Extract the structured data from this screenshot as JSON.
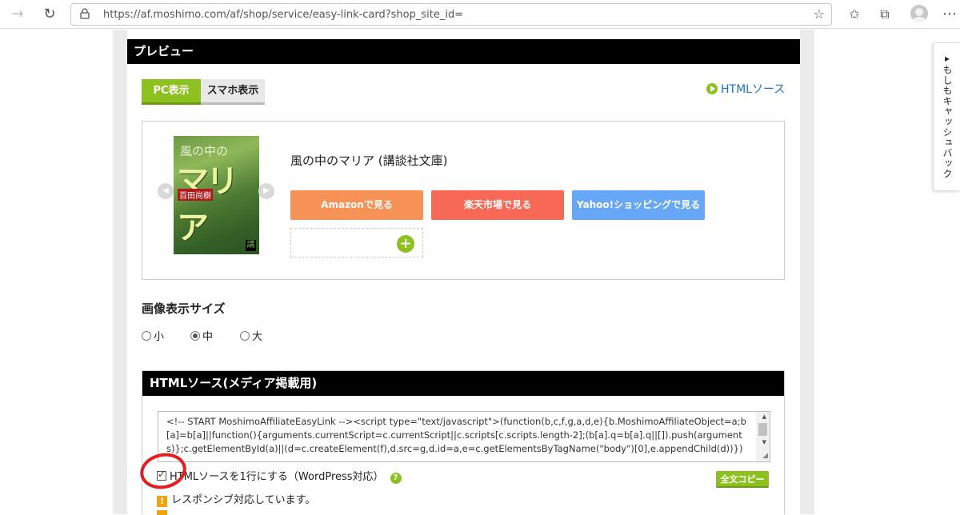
{
  "browser": {
    "url": "https://af.moshimo.com/af/shop/service/easy-link-card?shop_site_id="
  },
  "preview": {
    "title": "プレビュー",
    "tabs": [
      {
        "label": "PC表示",
        "active": true
      },
      {
        "label": "スマホ表示",
        "active": false
      }
    ],
    "html_source_link": "HTMLソース",
    "book": {
      "title": "風の中のマリア (講談社文庫)",
      "cover_title_small": "風の中の",
      "cover_title_big": "マリア",
      "cover_author": "百田尚樹"
    },
    "buttons": {
      "amazon": "Amazonで見る",
      "rakuten": "楽天市場で見る",
      "yahoo": "Yahoo!ショッピングで見る"
    }
  },
  "image_size": {
    "title": "画像表示サイズ",
    "options": [
      {
        "label": "小",
        "selected": false
      },
      {
        "label": "中",
        "selected": true
      },
      {
        "label": "大",
        "selected": false
      }
    ]
  },
  "html_source": {
    "title": "HTMLソース(メディア掲載用)",
    "code": "<!-- START MoshimoAffiliateEasyLink --><script type=\"text/javascript\">(function(b,c,f,g,a,d,e){b.MoshimoAffiliateObject=a;b[a]=b[a]||function(){arguments.currentScript=c.currentScript||c.scripts[c.scripts.length-2];(b[a].q=b[a].q||[]).push(arguments)};c.getElementById(a)||(d=c.createElement(f),d.src=g,d.id=a,e=c.getElementsByTagName(\"body\")[0],e.appendChild(d))})",
    "one_line_checkbox": "HTMLソースを1行にする（WordPress対応）",
    "one_line_checked": true,
    "copy_button": "全文コピー",
    "responsive_note": "レスポンシブ対応しています。"
  },
  "side_tab": {
    "label": "▸もしもキャッシュバック"
  },
  "colors": {
    "accent_green": "#8cc11f",
    "amazon": "#f79256",
    "rakuten": "#f76956",
    "yahoo": "#66a7f7",
    "annotation_red": "#e41e1e"
  }
}
